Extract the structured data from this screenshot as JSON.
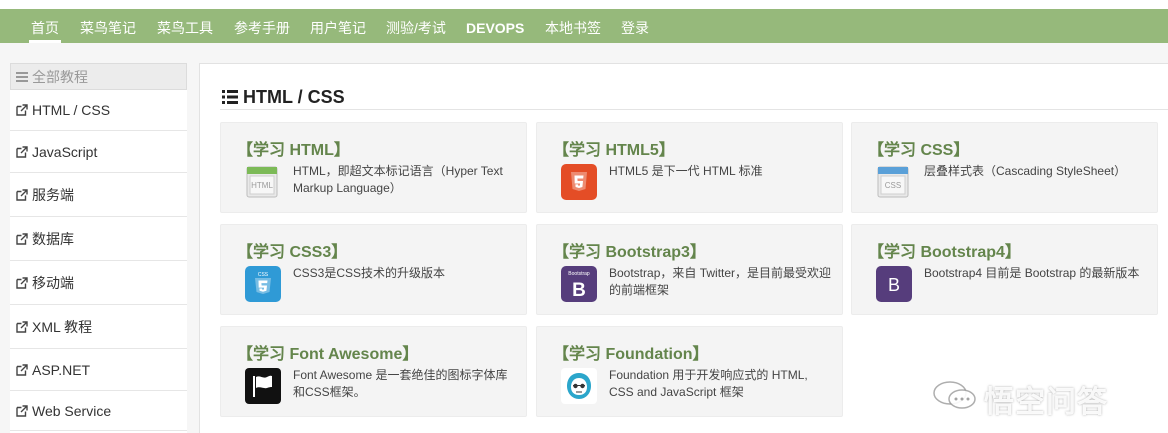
{
  "nav": {
    "items": [
      {
        "label": "首页",
        "active": true
      },
      {
        "label": "菜鸟笔记"
      },
      {
        "label": "菜鸟工具"
      },
      {
        "label": "参考手册"
      },
      {
        "label": "用户笔记"
      },
      {
        "label": "测验/考试"
      },
      {
        "label": "DEVOPS"
      },
      {
        "label": "本地书签"
      },
      {
        "label": "登录"
      }
    ]
  },
  "sidebar": {
    "heading": "全部教程",
    "items": [
      {
        "label": "HTML / CSS"
      },
      {
        "label": "JavaScript"
      },
      {
        "label": "服务端"
      },
      {
        "label": "数据库"
      },
      {
        "label": "移动端"
      },
      {
        "label": "XML 教程"
      },
      {
        "label": "ASP.NET"
      },
      {
        "label": "Web Service"
      }
    ]
  },
  "main": {
    "section_title": "HTML / CSS",
    "cards": [
      {
        "title": "【学习 HTML】",
        "desc": "HTML，即超文本标记语言（Hyper Text Markup Language）",
        "icon": "html-icon"
      },
      {
        "title": "【学习 HTML5】",
        "desc": "HTML5 是下一代 HTML 标准",
        "icon": "html5-icon"
      },
      {
        "title": "【学习 CSS】",
        "desc": "层叠样式表（Cascading StyleSheet）",
        "icon": "css-icon"
      },
      {
        "title": "【学习 CSS3】",
        "desc": "CSS3是CSS技术的升级版本",
        "icon": "css3-icon"
      },
      {
        "title": "【学习 Bootstrap3】",
        "desc": "Bootstrap，来自 Twitter，是目前最受欢迎的前端框架",
        "icon": "bootstrap3-icon"
      },
      {
        "title": "【学习 Bootstrap4】",
        "desc": "Bootstrap4 目前是 Bootstrap 的最新版本",
        "icon": "bootstrap4-icon"
      },
      {
        "title": "【学习 Font Awesome】",
        "desc": "Font Awesome 是一套绝佳的图标字体库和CSS框架。",
        "icon": "font-awesome-flag-icon"
      },
      {
        "title": "【学习 Foundation】",
        "desc": "Foundation 用于开发响应式的 HTML, CSS and JavaScript 框架",
        "icon": "foundation-icon"
      }
    ]
  },
  "icon_labels": {
    "html": "HTML",
    "css": "CSS",
    "css3": "CSS",
    "bootstrap3_tag": "Bootstrap",
    "bootstrap_letter": "B"
  },
  "watermark": {
    "text": "悟空问答"
  },
  "colors": {
    "nav_bg": "#96b97b",
    "card_title": "#64854c",
    "card_bg": "#f4f4f4",
    "html5_orange": "#e44d26",
    "css3_blue": "#2f9ad6",
    "bootstrap_purple": "#563d7c"
  }
}
